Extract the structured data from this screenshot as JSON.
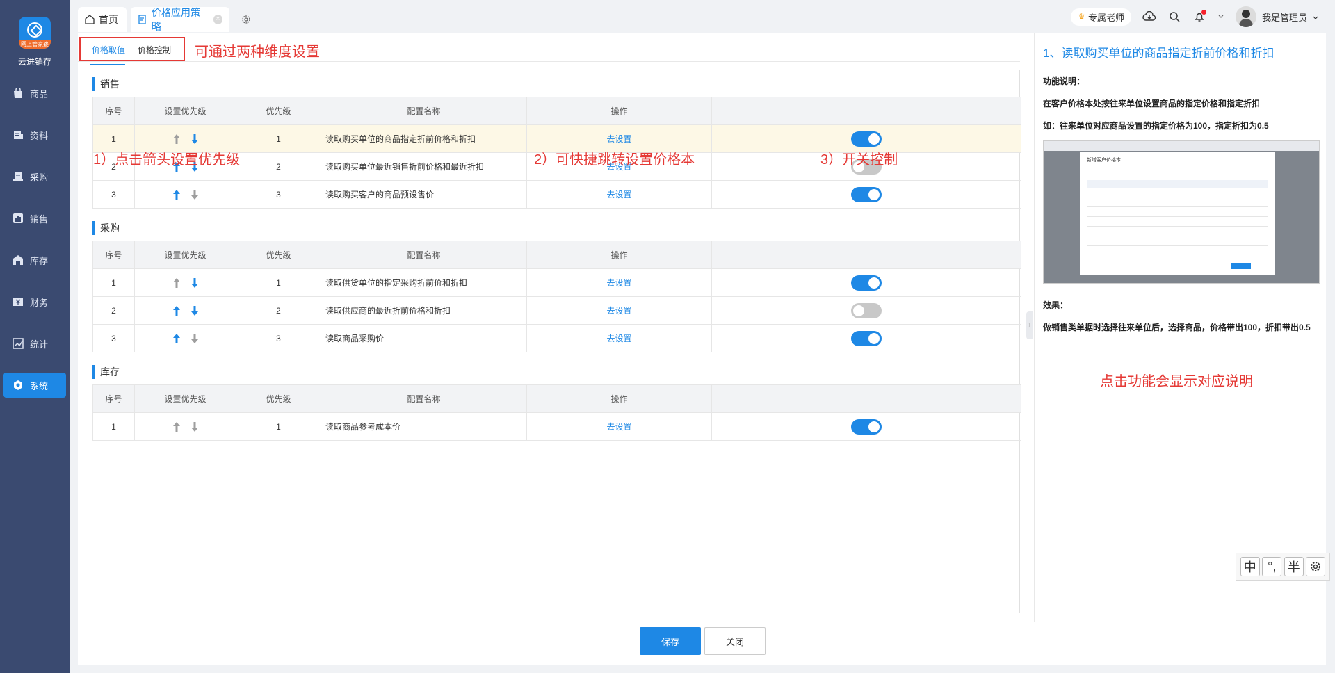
{
  "app": {
    "name": "云进销存",
    "logo_strip": "网上管家婆"
  },
  "sidebar": {
    "items": [
      {
        "label": "商品",
        "icon": "bag-icon"
      },
      {
        "label": "资料",
        "icon": "document-icon"
      },
      {
        "label": "采购",
        "icon": "purchase-icon"
      },
      {
        "label": "销售",
        "icon": "chart-icon"
      },
      {
        "label": "库存",
        "icon": "warehouse-icon"
      },
      {
        "label": "财务",
        "icon": "finance-icon"
      },
      {
        "label": "统计",
        "icon": "statistics-icon"
      },
      {
        "label": "系统",
        "icon": "system-icon",
        "active": true
      }
    ]
  },
  "tabs": [
    {
      "label": "首页"
    },
    {
      "label": "价格应用策略",
      "active": true,
      "close": "×"
    }
  ],
  "topright": {
    "teacher": "专属老师",
    "user": "我是管理员"
  },
  "subtabs": [
    {
      "label": "价格取值",
      "active": true
    },
    {
      "label": "价格控制"
    }
  ],
  "annotations": {
    "subtabs_note": "可通过两种维度设置",
    "arrow_note": "1）点击箭头设置优先级",
    "link_note": "2）可快捷跳转设置价格本",
    "toggle_note": "3）开关控制",
    "help_note": "点击功能会显示对应说明"
  },
  "columns": {
    "seq": "序号",
    "set_priority": "设置优先级",
    "priority": "优先级",
    "config_name": "配置名称",
    "action": "操作"
  },
  "sections": [
    {
      "title": "销售",
      "rows": [
        {
          "seq": "1",
          "priority": "1",
          "name": "读取购买单位的商品指定折前价格和折扣",
          "action": "去设置",
          "toggle": true,
          "highlight": true,
          "up": false,
          "down": true
        },
        {
          "seq": "2",
          "priority": "2",
          "name": "读取购买单位最近销售折前价格和最近折扣",
          "action": "去设置",
          "toggle": false,
          "up": true,
          "down": true
        },
        {
          "seq": "3",
          "priority": "3",
          "name": "读取购买客户的商品预设售价",
          "action": "去设置",
          "toggle": true,
          "up": true,
          "down": false
        }
      ]
    },
    {
      "title": "采购",
      "rows": [
        {
          "seq": "1",
          "priority": "1",
          "name": "读取供货单位的指定采购折前价和折扣",
          "action": "去设置",
          "toggle": true,
          "up": false,
          "down": true
        },
        {
          "seq": "2",
          "priority": "2",
          "name": "读取供应商的最近折前价格和折扣",
          "action": "去设置",
          "toggle": false,
          "up": true,
          "down": true
        },
        {
          "seq": "3",
          "priority": "3",
          "name": "读取商品采购价",
          "action": "去设置",
          "toggle": true,
          "up": true,
          "down": false
        }
      ]
    },
    {
      "title": "库存",
      "rows": [
        {
          "seq": "1",
          "priority": "1",
          "name": "读取商品参考成本价",
          "action": "去设置",
          "toggle": true,
          "up": false,
          "down": false
        }
      ]
    }
  ],
  "buttons": {
    "save": "保存",
    "close": "关闭"
  },
  "help": {
    "title": "1、读取购买单位的商品指定折前价格和折扣",
    "func_label": "功能说明：",
    "func_desc": "在客户价格本处按往来单位设置商品的指定价格和指定折扣",
    "example": "如：往来单位对应商品设置的指定价格为100，指定折扣为0.5",
    "effect_label": "效果：",
    "effect_desc": "做销售类单据时选择往来单位后，选择商品，价格带出100，折扣带出0.5",
    "shot_title": "新增客户价格本"
  },
  "ime": {
    "keys": [
      "中",
      "°,",
      "半"
    ]
  },
  "colors": {
    "accent": "#1e88e5",
    "sidebar": "#3a4a70",
    "annotation": "#e53935",
    "highlight_row": "#fdf8e6"
  }
}
